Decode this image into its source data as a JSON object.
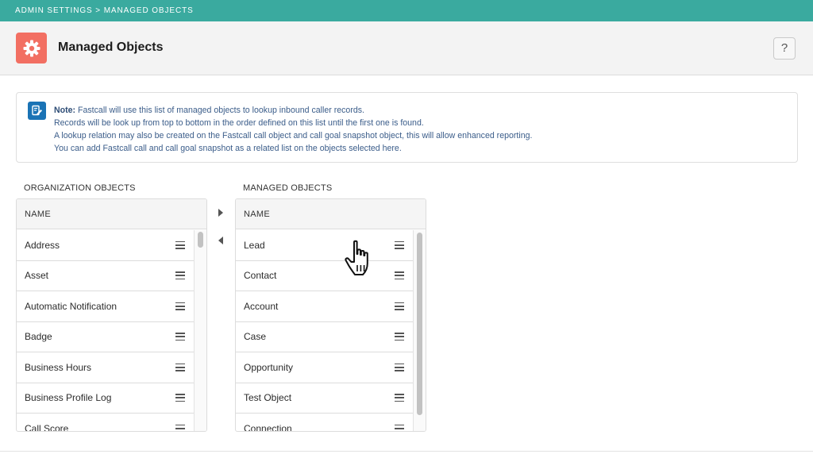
{
  "breadcrumb": "ADMIN SETTINGS > MANAGED OBJECTS",
  "header": {
    "title": "Managed Objects",
    "help_label": "?"
  },
  "note": {
    "lead": "Note:",
    "lines": [
      " Fastcall will use this list of managed objects to lookup inbound caller records.",
      "Records will be look up from top to bottom in the order defined on this list until the first one is found.",
      "A lookup relation may also be created on the Fastcall call object and call goal snapshot object, this will allow enhanced reporting.",
      "You can add Fastcall call and call goal snapshot as a related list on the objects selected here."
    ]
  },
  "organization": {
    "label": "ORGANIZATION OBJECTS",
    "column": "NAME",
    "items": [
      "Address",
      "Asset",
      "Automatic Notification",
      "Badge",
      "Business Hours",
      "Business Profile Log",
      "Call Score"
    ]
  },
  "managed": {
    "label": "MANAGED OBJECTS",
    "column": "NAME",
    "items": [
      "Lead",
      "Contact",
      "Account",
      "Case",
      "Opportunity",
      "Test Object",
      "Connection"
    ]
  },
  "colors": {
    "topbar": "#3aaa9f",
    "header_icon": "#f26f62",
    "note_icon": "#1a73b5"
  },
  "icons": {
    "header": "gear-icon",
    "note": "note-edit-icon",
    "help": "question-icon",
    "move_right": "triangle-right-icon",
    "move_left": "triangle-left-icon",
    "row_handle": "drag-handle-icon"
  }
}
